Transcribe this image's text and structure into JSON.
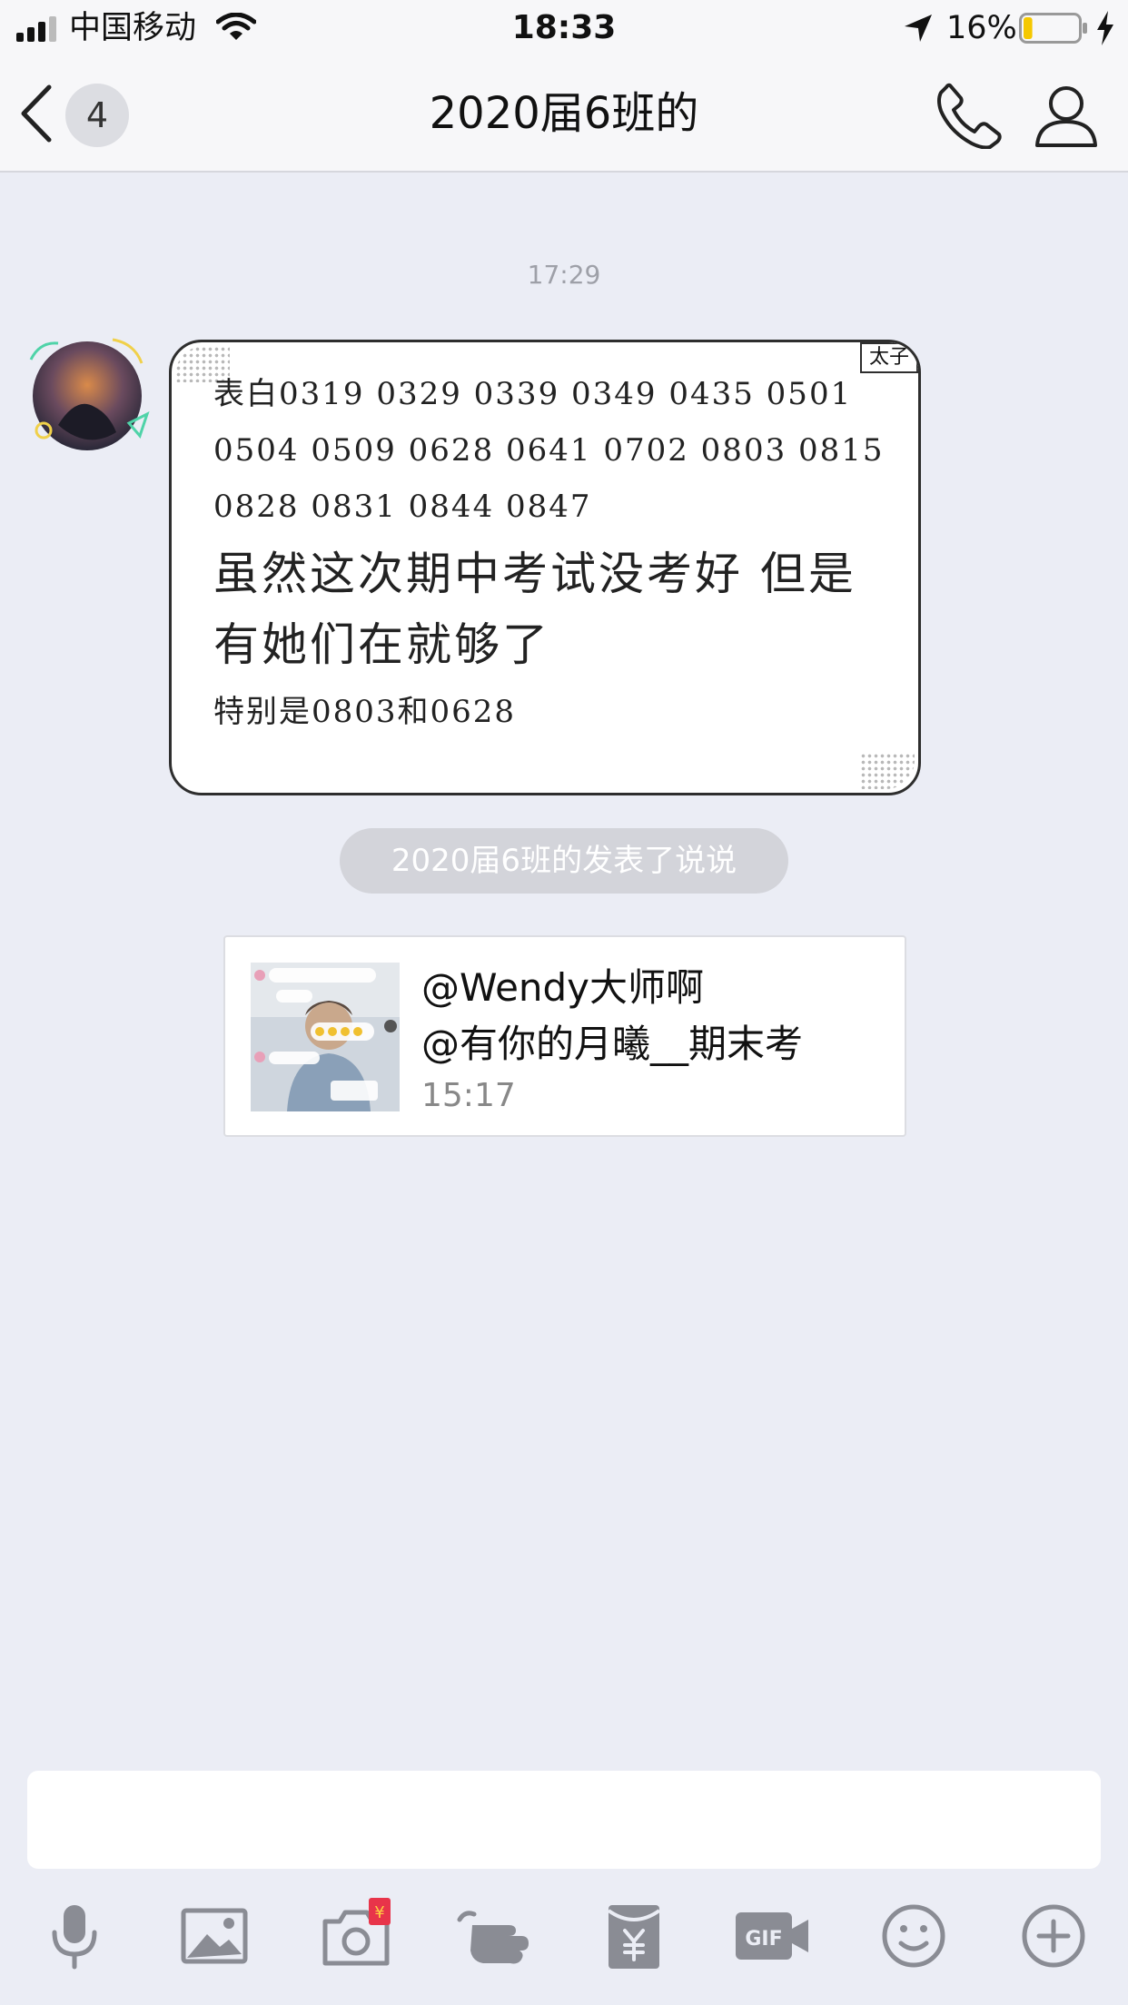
{
  "status_bar": {
    "carrier": "中国移动",
    "time": "18:33",
    "battery_percent": "16%",
    "battery_level": 0.16,
    "icons": [
      "signal-icon",
      "wifi-icon",
      "location-icon",
      "battery-icon",
      "charging-icon"
    ]
  },
  "nav": {
    "back_icon": "chevron-left-icon",
    "unread_count": "4",
    "title": "2020届6班的",
    "call_icon": "phone-icon",
    "profile_icon": "profile-icon"
  },
  "chat": {
    "timestamp": "17:29",
    "message": {
      "tag": "太子",
      "line1": "表白0319 0329 0339 0349 0435 0501 0504 0509 0628 0641 0702 0803 0815 0828 0831 0844 0847",
      "line2": "虽然这次期中考试没考好 但是有她们在就够了",
      "line3": "特别是0803和0628"
    },
    "notice": "2020届6班的发表了说说",
    "post": {
      "line1": "@Wendy大师啊",
      "line2": "@有你的月曦__期末考",
      "time": "15:17"
    }
  },
  "input": {
    "placeholder": ""
  },
  "toolbar": {
    "icons": [
      "microphone-icon",
      "image-icon",
      "camera-icon",
      "poke-icon",
      "red-packet-icon",
      "gif-icon",
      "emoji-icon",
      "plus-icon"
    ],
    "red_packet_symbol": "¥"
  },
  "colors": {
    "background": "#ebedf5",
    "bar": "#f7f7f9",
    "battery_fill": "#f5c800"
  }
}
